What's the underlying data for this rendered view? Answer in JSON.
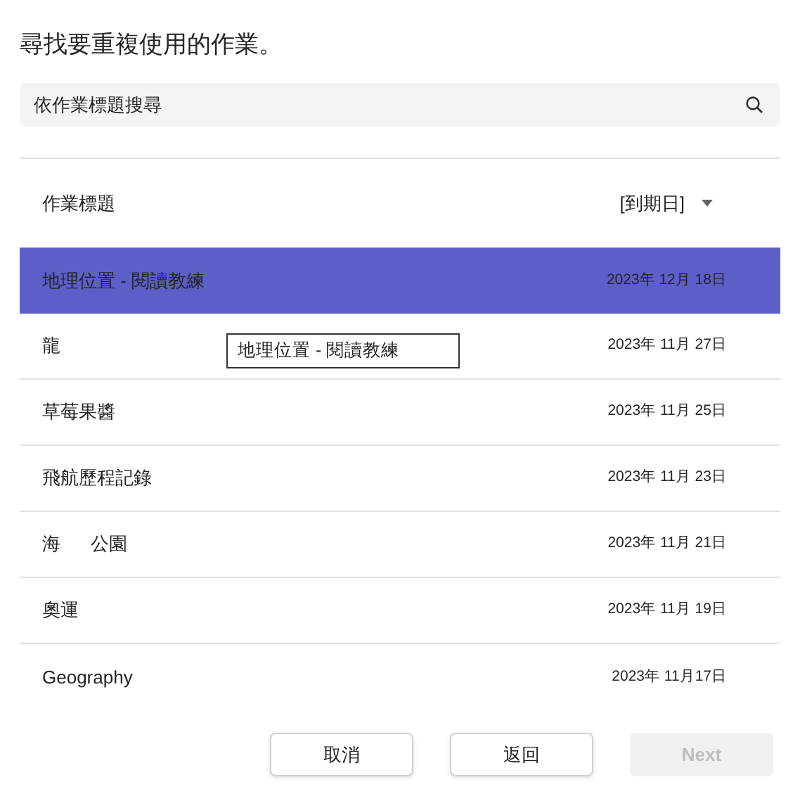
{
  "title": "尋找要重複使用的作業。",
  "search": {
    "placeholder": "依作業標題搜尋"
  },
  "columns": {
    "title": "作業標題",
    "sort": "[到期日]"
  },
  "rows": [
    {
      "title": "地理位置 - 閱讀教練",
      "date": "2023年 12月 18日",
      "selected": true
    },
    {
      "title": "龍",
      "date": "2023年 11月 27日",
      "selected": false
    },
    {
      "title": "草莓果醬",
      "date": "2023年 11月 25日",
      "selected": false
    },
    {
      "title": "飛航歷程記錄",
      "date": "2023年 11月 23日",
      "selected": false
    },
    {
      "title": "海      公園",
      "date": "2023年 11月 21日",
      "selected": false
    },
    {
      "title": "奧運",
      "date": "2023年 11月 19日",
      "selected": false
    },
    {
      "title": "Geography",
      "date": "2023年 11月17日",
      "selected": false
    }
  ],
  "tooltip": "地理位置 - 閱讀教練",
  "buttons": [
    {
      "label": "取消",
      "disabled": false
    },
    {
      "label": "返回",
      "disabled": false
    },
    {
      "label": "Next",
      "disabled": true
    }
  ]
}
